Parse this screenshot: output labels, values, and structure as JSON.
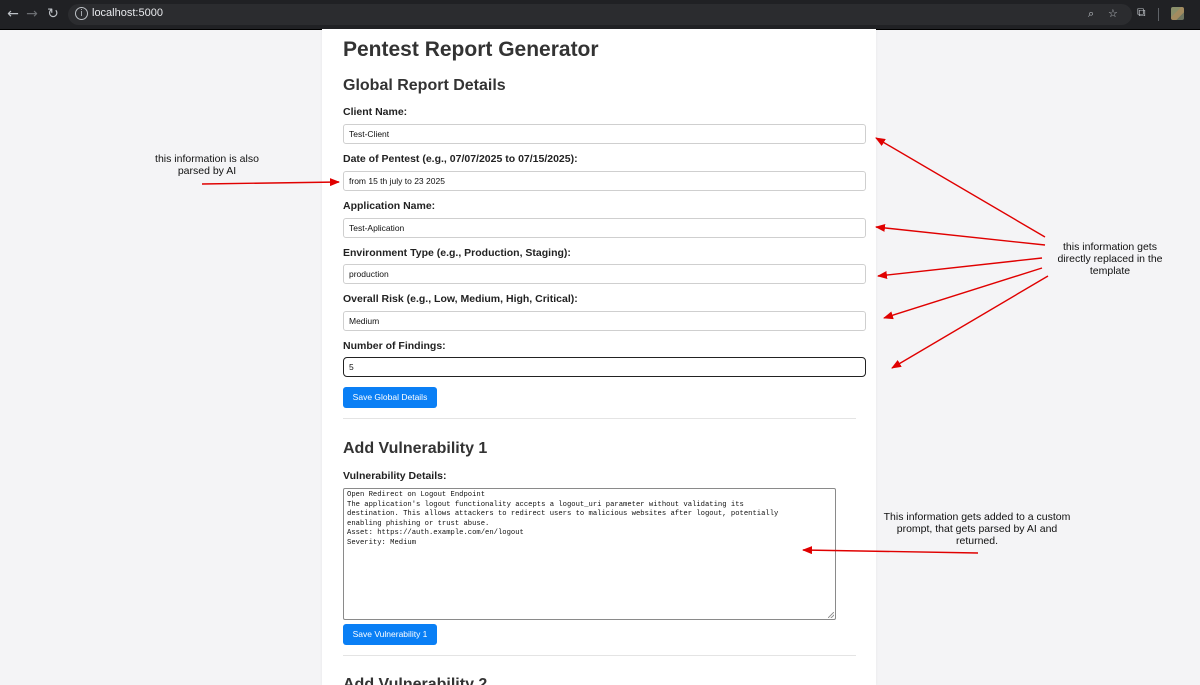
{
  "browser": {
    "url": "localhost:5000",
    "back_icon": "arrow-left-icon",
    "forward_icon": "arrow-right-icon",
    "reload_icon": "reload-icon",
    "info_icon": "info-icon",
    "zoom_icon": "zoom-icon",
    "bookmark_icon": "star-icon",
    "extensions_icon": "puzzle-icon"
  },
  "page": {
    "title": "Pentest Report Generator",
    "global_heading": "Global Report Details",
    "fields": [
      {
        "label": "Client Name:",
        "value": "Test-Client"
      },
      {
        "label": "Date of Pentest (e.g., 07/07/2025 to 07/15/2025):",
        "value": "from 15 th july to 23 2025"
      },
      {
        "label": "Application Name:",
        "value": "Test-Aplication"
      },
      {
        "label": "Environment Type (e.g., Production, Staging):",
        "value": "production"
      },
      {
        "label": "Overall Risk (e.g., Low, Medium, High, Critical):",
        "value": "Medium"
      },
      {
        "label": "Number of Findings:",
        "value": "5"
      }
    ],
    "save_global_label": "Save Global Details",
    "vuln1": {
      "heading": "Add Vulnerability 1",
      "details_label": "Vulnerability Details:",
      "details_value": "Open Redirect on Logout Endpoint\nThe application's logout functionality accepts a logout_uri parameter without validating its\ndestination. This allows attackers to redirect users to malicious websites after logout, potentially\nenabling phishing or trust abuse.\nAsset: https://auth.example.com/en/logout\nSeverity: Medium",
      "save_label": "Save Vulnerability 1"
    },
    "vuln2": {
      "heading": "Add Vulnerability 2"
    }
  },
  "annotations": {
    "left_note": "this information is also\nparsed by AI",
    "right_note": "this information gets\ndirectly replaced in the\ntemplate",
    "bottom_note": "This information gets added to a custom\nprompt, that gets parsed by AI and\nreturned.",
    "arrow_color": "#e00000"
  }
}
